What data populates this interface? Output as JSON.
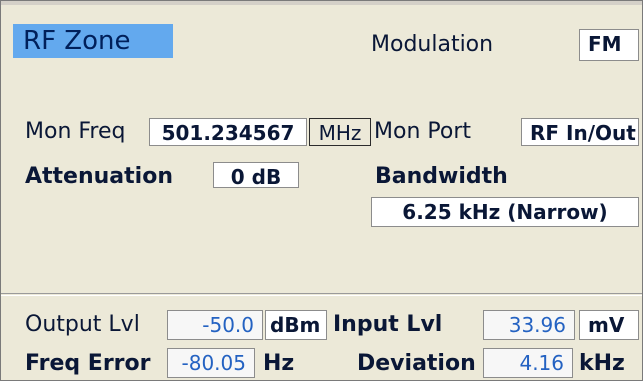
{
  "zone": {
    "title": "RF Zone"
  },
  "modulation": {
    "label": "Modulation",
    "value": "FM"
  },
  "mon_freq": {
    "label": "Mon Freq",
    "value": "501.234567",
    "unit": "MHz"
  },
  "mon_port": {
    "label": "Mon Port",
    "value": "RF In/Out"
  },
  "attenuation": {
    "label": "Attenuation",
    "value": "0 dB"
  },
  "bandwidth": {
    "label": "Bandwidth",
    "value": "6.25 kHz (Narrow)"
  },
  "output_lvl": {
    "label": "Output Lvl",
    "value": "-50.0",
    "unit": "dBm"
  },
  "input_lvl": {
    "label": "Input Lvl",
    "value": "33.96",
    "unit": "mV"
  },
  "freq_error": {
    "label": "Freq Error",
    "value": "-80.05",
    "unit": "Hz"
  },
  "deviation": {
    "label": "Deviation",
    "value": "4.16",
    "unit": "kHz"
  },
  "colors": {
    "title_bg": "#63A9EE",
    "panel_bg": "#ECE9D8",
    "reading_text": "#2462C2"
  }
}
